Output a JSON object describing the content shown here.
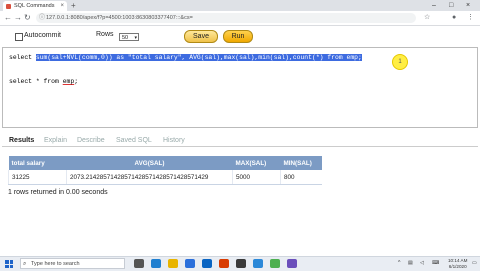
{
  "browser": {
    "tab_title": "SQL Commands",
    "tab_close": "×",
    "new_tab": "+",
    "url": "127.0.0.1:8080/apex/f?p=4500:1003:8630803377407:::&cs=",
    "window_controls": [
      "–",
      "□",
      "×"
    ]
  },
  "controls": {
    "autocommit_label": "Autocommit",
    "rows_label": "Rows",
    "rows_value": "50",
    "save_label": "Save",
    "run_label": "Run"
  },
  "editor": {
    "line1_keyword": "select ",
    "line1_selected": "sum(sal+NVL(comm,0)) as \"total salary\", AVG(sal),max(sal),min(sal),count(*) from emp;",
    "line2_prefix": "select * from ",
    "line2_table": "emp",
    "line2_suffix": ";",
    "marker": "1"
  },
  "results_tabs": [
    "Results",
    "Explain",
    "Describe",
    "Saved SQL",
    "History"
  ],
  "table": {
    "headers": [
      "total salary",
      "AVG(SAL)",
      "MAX(SAL)",
      "MIN(SAL)"
    ],
    "row": [
      "31225",
      "2073.21428571428571428571428571428571429",
      "5000",
      "800"
    ]
  },
  "rows_message": "1 rows returned in 0.00 seconds",
  "taskbar": {
    "search_placeholder": "Type here to search",
    "clock_time": "10:14 AM",
    "clock_date": "6/1/2020"
  },
  "colors": {
    "selection": "#3d6be0",
    "table_header": "#7c9bc4",
    "run_button": "#f0a800"
  }
}
